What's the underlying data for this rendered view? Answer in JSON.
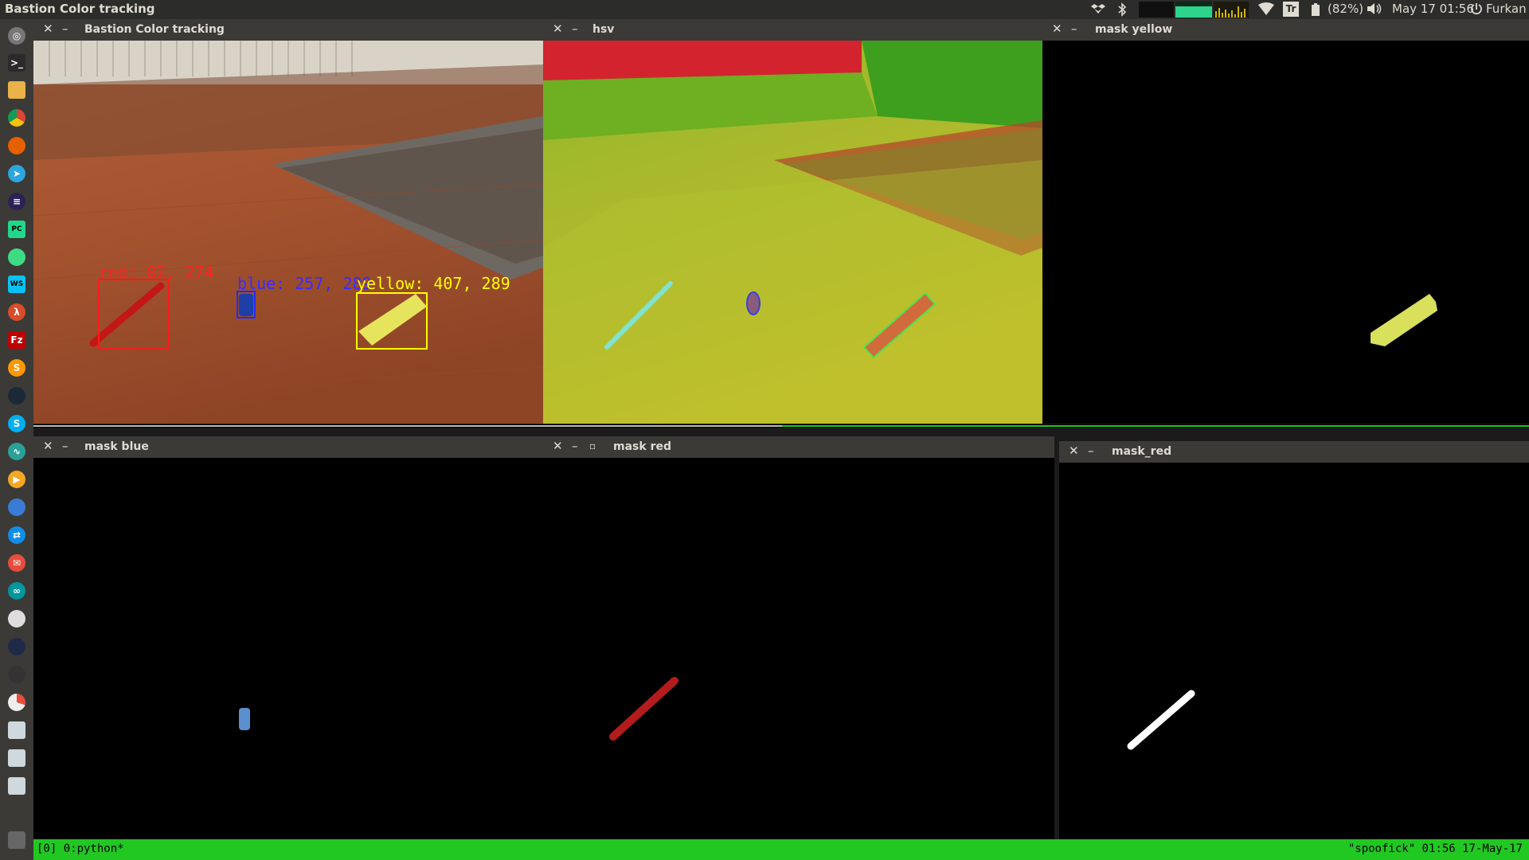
{
  "topbar": {
    "app_title": "Bastion Color tracking",
    "battery": "(82%)",
    "clock": "May 17 01:56",
    "user": "Furkan",
    "tray_icons": [
      "dropbox-icon",
      "bluetooth-icon",
      "system-monitor-icon",
      "wifi-icon",
      "keyboard-layout-icon",
      "battery-icon",
      "volume-icon",
      "power-icon"
    ],
    "keyboard_layout": "Tr"
  },
  "launcher": {
    "icons": [
      "dash-home-icon",
      "terminal-icon",
      "files-icon",
      "chrome-icon",
      "firefox-icon",
      "telegram-icon",
      "eclipse-icon",
      "pycharm-icon",
      "android-studio-icon",
      "webstorm-icon",
      "lambda-icon",
      "filezilla-icon",
      "sublime-icon",
      "steam-icon",
      "skype-icon",
      "system-monitor-icon",
      "player-icon",
      "network-icon",
      "teamviewer-icon",
      "mail-icon",
      "arduino-icon",
      "settings-icon",
      "obs-icon",
      "paint-icon",
      "chart-icon",
      "script-icon",
      "script-icon-2",
      "script-icon-3",
      "trash-icon"
    ]
  },
  "windows": {
    "tracking": {
      "title": "Bastion Color tracking",
      "labels": {
        "red": "red: 82, 274",
        "blue": "blue: 257, 289",
        "yellow": "yellow: 407, 289"
      },
      "colors": {
        "red_box": "#ff1a1a",
        "blue_box": "#1f2cff",
        "yellow_box": "#ffff00"
      }
    },
    "hsv": {
      "title": "hsv"
    },
    "mask_yellow": {
      "title": "mask yellow"
    },
    "mask_blue": {
      "title": "mask blue"
    },
    "mask_red": {
      "title": "mask red"
    },
    "mask_red_binary": {
      "title": "mask_red"
    }
  },
  "tmux": {
    "left": "[0] 0:python*",
    "right": "\"spoofick\" 01:56 17-May-17"
  }
}
